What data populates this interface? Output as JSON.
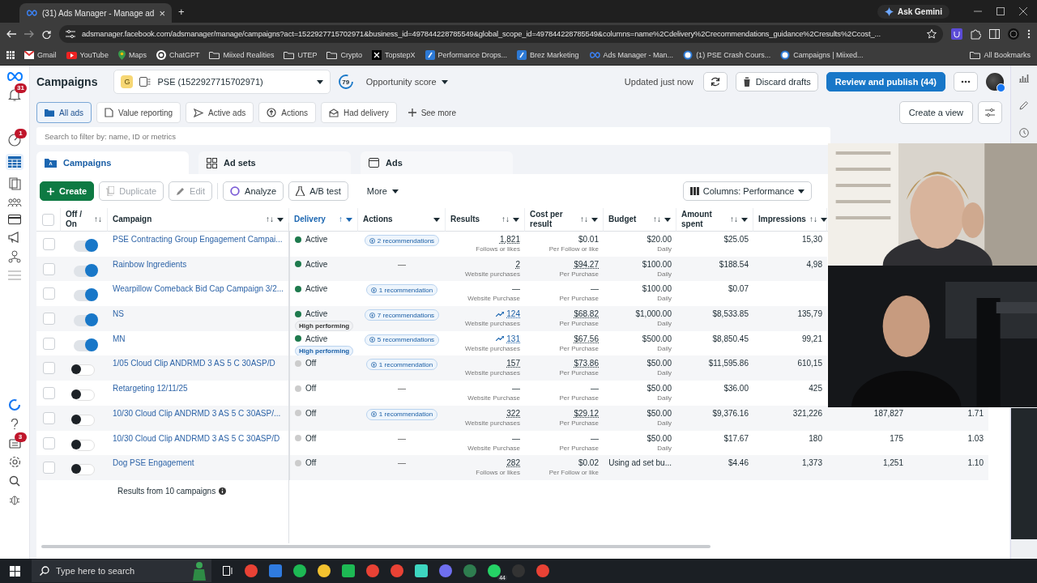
{
  "browser": {
    "tab_title": "(31) Ads Manager - Manage ad",
    "tab_close": "×",
    "new_tab": "+",
    "ask_gemini": "Ask Gemini",
    "url": "adsmanager.facebook.com/adsmanager/manage/campaigns?act=1522927715702971&business_id=497844228785549&global_scope_id=497844228785549&columns=name%2Cdelivery%2Crecommendations_guidance%2Cresults%2Ccost_...",
    "bookmarks": [
      {
        "label": "Gmail",
        "kind": "mail"
      },
      {
        "label": "YouTube",
        "kind": "video"
      },
      {
        "label": "Maps",
        "kind": "pin"
      },
      {
        "label": "ChatGPT",
        "kind": "knot"
      },
      {
        "label": "Miixed Realities",
        "kind": "folder"
      },
      {
        "label": "UTEP",
        "kind": "folder"
      },
      {
        "label": "Crypto",
        "kind": "folder"
      },
      {
        "label": "TopstepX",
        "kind": "x"
      },
      {
        "label": "Performance Drops...",
        "kind": "tile"
      },
      {
        "label": "Brez Marketing",
        "kind": "tile"
      },
      {
        "label": "Ads Manager - Man...",
        "kind": "loop"
      },
      {
        "label": "(1) PSE Crash Cours...",
        "kind": "ring"
      },
      {
        "label": "Campaigns | Miixed...",
        "kind": "ring"
      }
    ],
    "all_bookmarks": "All Bookmarks"
  },
  "nav": {
    "notifications_badge": "31",
    "alerts_badge": "1",
    "items_badge": "3"
  },
  "header": {
    "title": "Campaigns",
    "account_initial": "G",
    "account": "PSE (1522927715702971)",
    "score": "79",
    "score_label": "Opportunity score",
    "status": "Updated just now",
    "discard": "Discard drafts",
    "publish": "Review and publish (44)"
  },
  "filters": [
    {
      "label": "All ads",
      "selected": true,
      "kind": "folder"
    },
    {
      "label": "Value reporting",
      "selected": false,
      "kind": "report"
    },
    {
      "label": "Active ads",
      "selected": false,
      "kind": "send"
    },
    {
      "label": "Actions",
      "selected": false,
      "kind": "up"
    },
    {
      "label": "Had delivery",
      "selected": false,
      "kind": "mail"
    }
  ],
  "see_more": "See more",
  "create_view": "Create a view",
  "search": {
    "placeholder": "Search to filter by: name, ID or metrics"
  },
  "level_tabs": [
    {
      "label": "Campaigns",
      "selected": true,
      "kind": "folder"
    },
    {
      "label": "Ad sets",
      "selected": false,
      "kind": "grid"
    },
    {
      "label": "Ads",
      "selected": false,
      "kind": "window"
    }
  ],
  "toolbar": {
    "create": "Create",
    "duplicate": "Duplicate",
    "edit": "Edit",
    "analyze": "Analyze",
    "ab_test": "A/B test",
    "more": "More",
    "columns": "Columns: Performance",
    "duplicate_disabled": true,
    "edit_disabled": true
  },
  "table": {
    "select_all_checked": false,
    "columns": [
      {
        "label": "Off / On",
        "sort": "↑↓",
        "menu": false,
        "selected": false
      },
      {
        "label": "Campaign",
        "sort": "↑↓",
        "menu": true,
        "selected": false
      },
      {
        "label": "Delivery",
        "sort": "↑",
        "menu": true,
        "selected": true
      },
      {
        "label": "Actions",
        "menu": true,
        "selected": false
      },
      {
        "label": "Results",
        "sort": "↑↓",
        "menu": true,
        "selected": false
      },
      {
        "label": "Cost per result",
        "sort": "↑↓",
        "menu": true,
        "selected": false
      },
      {
        "label": "Budget",
        "sort": "↑↓",
        "menu": true,
        "selected": false
      },
      {
        "label": "Amount spent",
        "sort": "↑↓",
        "menu": true,
        "selected": false
      },
      {
        "label": "Impressions",
        "sort": "↑↓",
        "menu": true,
        "selected": false
      }
    ],
    "rows": [
      {
        "checked": false,
        "on": true,
        "name": "PSE Contracting Group Engagement Campai...",
        "delivery": "Active",
        "color": "#1e7a4d",
        "actions": {
          "kind": "recommendation",
          "text": "2 recommendations"
        },
        "results": {
          "value": "1,821",
          "linked": true,
          "trend": false,
          "label": "Follows or likes"
        },
        "cost": {
          "value": "$0.01",
          "linked": false,
          "label": "Per Follow or like"
        },
        "budget": {
          "value": "$20.00",
          "label": "Daily"
        },
        "spent": "$25.05",
        "impressions": "15,30"
      },
      {
        "checked": false,
        "on": true,
        "name": "Rainbow Ingredients",
        "delivery": "Active",
        "color": "#1e7a4d",
        "actions": {
          "kind": "empty",
          "text": "—"
        },
        "results": {
          "value": "2",
          "linked": true,
          "trend": false,
          "label": "Website purchases"
        },
        "cost": {
          "value": "$94.27",
          "linked": true,
          "label": "Per Purchase"
        },
        "budget": {
          "value": "$100.00",
          "label": "Daily"
        },
        "spent": "$188.54",
        "impressions": "4,98"
      },
      {
        "checked": false,
        "on": true,
        "name": "Wearpillow Comeback Bid Cap Campaign 3/2...",
        "delivery": "Active",
        "color": "#1e7a4d",
        "actions": {
          "kind": "recommendation",
          "text": "1 recommendation"
        },
        "results": {
          "value": "—",
          "linked": false,
          "trend": false,
          "label": "Website Purchase"
        },
        "cost": {
          "value": "—",
          "linked": false,
          "label": "Per Purchase"
        },
        "budget": {
          "value": "$100.00",
          "label": "Daily"
        },
        "spent": "$0.07"
      },
      {
        "checked": false,
        "on": true,
        "name": "NS",
        "delivery": "Active",
        "color": "#1e7a4d",
        "badge": {
          "text": "High performing",
          "kind": "neutral"
        },
        "actions": {
          "kind": "recommendation",
          "text": "7 recommendations"
        },
        "results": {
          "value": "124",
          "linked": true,
          "trend": true,
          "label": "Website purchases"
        },
        "cost": {
          "value": "$68.82",
          "linked": true,
          "label": "Per Purchase"
        },
        "budget": {
          "value": "$1,000.00",
          "label": "Daily"
        },
        "spent": "$8,533.85",
        "impressions": "135,79"
      },
      {
        "checked": false,
        "on": true,
        "name": "MN",
        "delivery": "Active",
        "color": "#1e7a4d",
        "badge": {
          "text": "High performing",
          "kind": "highlight"
        },
        "actions": {
          "kind": "recommendation",
          "text": "5 recommendations"
        },
        "results": {
          "value": "131",
          "linked": true,
          "trend": true,
          "label": "Website purchases"
        },
        "cost": {
          "value": "$67.56",
          "linked": true,
          "label": "Per Purchase"
        },
        "budget": {
          "value": "$500.00",
          "label": "Daily"
        },
        "spent": "$8,850.45",
        "impressions": "99,21"
      },
      {
        "checked": false,
        "on": false,
        "name": "1/05 Cloud Clip ANDRMD 3 AS 5 C 30ASP/D",
        "delivery": "Off",
        "color": "#cccccc",
        "actions": {
          "kind": "recommendation",
          "text": "1 recommendation"
        },
        "results": {
          "value": "157",
          "linked": true,
          "trend": false,
          "label": "Website purchases"
        },
        "cost": {
          "value": "$73.86",
          "linked": true,
          "label": "Per Purchase"
        },
        "budget": {
          "value": "$50.00",
          "label": "Daily"
        },
        "spent": "$11,595.86",
        "impressions": "610,15"
      },
      {
        "checked": false,
        "on": false,
        "name": "Retargeting 12/11/25",
        "delivery": "Off",
        "color": "#cccccc",
        "actions": {
          "kind": "empty",
          "text": "—"
        },
        "results": {
          "value": "—",
          "linked": false,
          "trend": false,
          "label": "Website Purchase"
        },
        "cost": {
          "value": "—",
          "linked": false,
          "label": "Per Purchase"
        },
        "budget": {
          "value": "$50.00",
          "label": "Daily"
        },
        "spent": "$36.00",
        "impressions": "425"
      },
      {
        "checked": false,
        "on": false,
        "name": "10/30 Cloud Clip ANDRMD 3 AS 5 C 30ASP/...",
        "delivery": "Off",
        "color": "#cccccc",
        "actions": {
          "kind": "recommendation",
          "text": "1 recommendation"
        },
        "results": {
          "value": "322",
          "linked": true,
          "trend": false,
          "label": "Website purchases"
        },
        "cost": {
          "value": "$29.12",
          "linked": true,
          "label": "Per Purchase"
        },
        "budget": {
          "value": "$50.00",
          "label": "Daily"
        },
        "spent": "$9,376.16",
        "impressions": "321,226",
        "column_11": "187,827",
        "column_12": "1.71"
      },
      {
        "checked": false,
        "on": false,
        "name": "10/30 Cloud Clip ANDRMD 3 AS 5 C 30ASP/D",
        "delivery": "Off",
        "color": "#cccccc",
        "actions": {
          "kind": "empty",
          "text": "—"
        },
        "results": {
          "value": "—",
          "linked": false,
          "trend": false,
          "label": "Website Purchase"
        },
        "cost": {
          "value": "—",
          "linked": false,
          "label": "Per Purchase"
        },
        "budget": {
          "value": "$50.00",
          "label": "Daily"
        },
        "spent": "$17.67",
        "impressions": "180",
        "column_11": "175",
        "column_12": "1.03"
      },
      {
        "checked": false,
        "on": false,
        "name": "Dog PSE Engagement",
        "delivery": "Off",
        "color": "#cccccc",
        "actions": {
          "kind": "empty",
          "text": "—"
        },
        "results": {
          "value": "282",
          "linked": true,
          "trend": false,
          "label": "Follows or likes"
        },
        "cost": {
          "value": "$0.02",
          "linked": false,
          "label": "Per Follow or like"
        },
        "budget": {
          "value": "Using ad set bu..."
        },
        "spent": "$4.46",
        "impressions": "1,373",
        "column_11": "1,251",
        "column_12": "1.10"
      }
    ],
    "footer": "Results from 10 campaigns"
  },
  "taskbar": {
    "search_placeholder": "Type here to search",
    "chat_badge": "44"
  }
}
